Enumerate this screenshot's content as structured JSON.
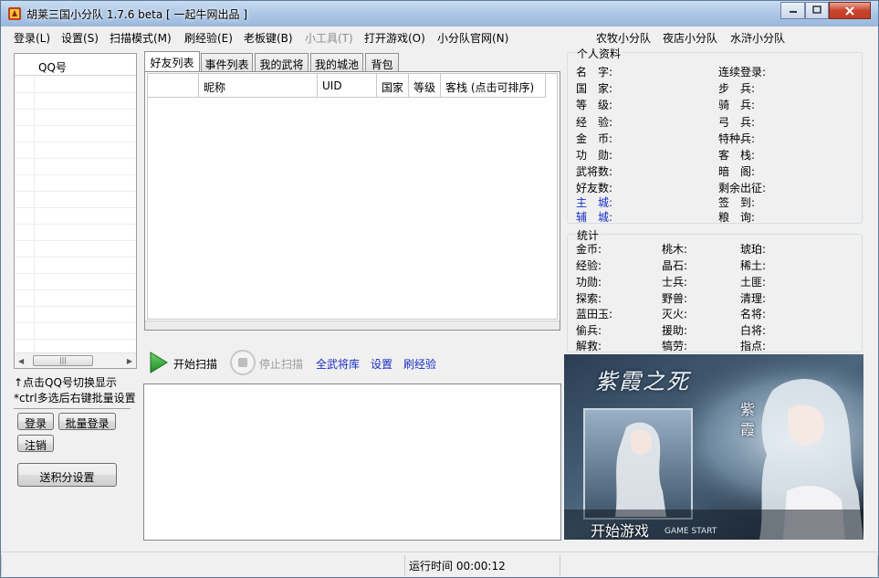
{
  "window": {
    "title": "胡莱三国小分队 1.7.6 beta [ 一起牛网出品 ]"
  },
  "menu": {
    "items": [
      "登录(L)",
      "设置(S)",
      "扫描模式(M)",
      "刷经验(E)",
      "老板键(B)",
      "小工具(T)",
      "打开游戏(O)",
      "小分队官网(N)"
    ],
    "right_links": [
      "农牧小分队",
      "夜店小分队",
      "水浒小分队"
    ]
  },
  "qq_list": {
    "header": "QQ号"
  },
  "left_hints": {
    "line1": "↑点击QQ号切换显示",
    "line2": "*ctrl多选后右键批量设置"
  },
  "left_buttons": {
    "login": "登录",
    "batch_login": "批量登录",
    "logout": "注销",
    "points_settings": "送积分设置"
  },
  "tabs": [
    "好友列表",
    "事件列表",
    "我的武将",
    "我的城池",
    "背包"
  ],
  "friend_table": {
    "columns": [
      "",
      "昵称",
      "UID",
      "国家",
      "等级",
      "客栈 (点击可排序)"
    ]
  },
  "actions": {
    "start_scan": "开始扫描",
    "stop_scan": "停止扫描",
    "all_generals": "全武将库",
    "settings": "设置",
    "brush_exp": "刷经验"
  },
  "profile": {
    "title": "个人资料",
    "left_fields": [
      "名　字:",
      "国　家:",
      "等　级:",
      "经　验:",
      "金　币:",
      "功　勋:",
      "武将数:",
      "好友数:",
      "主　城:",
      "辅　城:"
    ],
    "right_fields": [
      "连续登录:",
      "步　兵:",
      "骑　兵:",
      "弓　兵:",
      "特种兵:",
      "客　栈:",
      "暗　阁:",
      "剩余出征:",
      "签　到:",
      "粮　询:"
    ]
  },
  "stats": {
    "title": "统计",
    "col1": [
      "金币:",
      "经验:",
      "功勋:",
      "探索:",
      "蓝田玉:",
      "偷兵:",
      "解救:"
    ],
    "col2": [
      "桃木:",
      "晶石:",
      "士兵:",
      "野兽:",
      "灭火:",
      "援助:",
      "犒劳:"
    ],
    "col3": [
      "琥珀:",
      "稀土:",
      "土匪:",
      "清理:",
      "名将:",
      "白将:",
      "指点:"
    ]
  },
  "banner": {
    "title": "紫霞之死",
    "name": "紫霞",
    "start": "开始游戏",
    "start_en": "GAME START"
  },
  "status": {
    "runtime": "运行时间 00:00:12"
  },
  "colors": {
    "link_blue": "#1a2ec3",
    "play_green": "#2fa22f",
    "title_gradient_top": "#c9dcf1",
    "close_red": "#c8452c"
  }
}
